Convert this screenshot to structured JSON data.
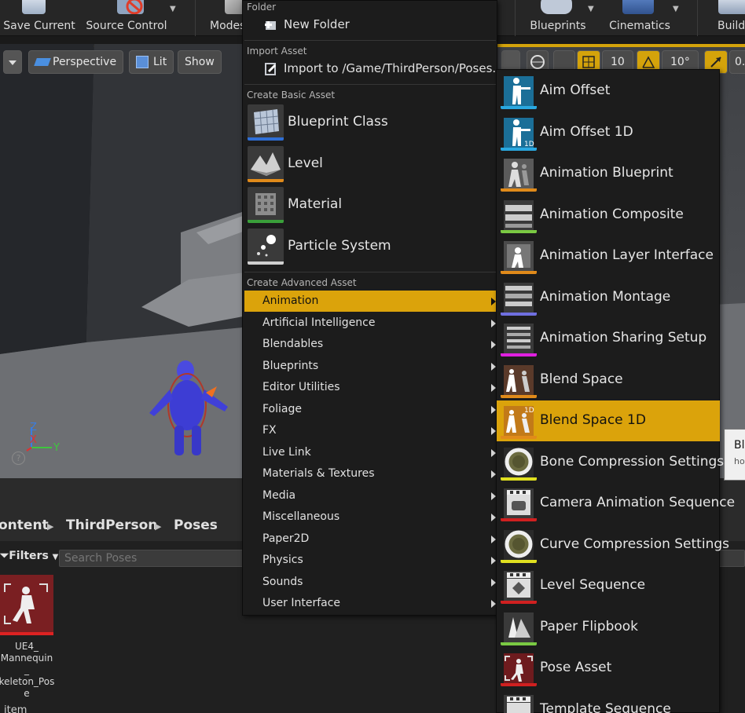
{
  "toolbar": {
    "save_current": "Save Current",
    "source_control": "Source Control",
    "modes": "Modes",
    "blueprints": "Blueprints",
    "cinematics": "Cinematics",
    "build": "Build"
  },
  "viewport": {
    "perspective": "Perspective",
    "lit": "Lit",
    "show": "Show",
    "grid_snap": "10",
    "rotation_snap": "10°",
    "scale_snap": "0.",
    "axis_z": "Z",
    "axis_x": "X",
    "axis_y": "Y",
    "help_glyph": "?"
  },
  "content_browser": {
    "breadcrumb": [
      "ontent",
      "ThirdPerson",
      "Poses"
    ],
    "filters_label": "Filters",
    "search_placeholder": "Search Poses",
    "asset_label": "UE4_ Mannequin_ keleton_Pose",
    "items_count": "item"
  },
  "tooltip": {
    "line1": "Bl",
    "line2": "ho"
  },
  "menu": {
    "folder_header": "Folder",
    "new_folder": "New Folder",
    "import_header": "Import Asset",
    "import_item": "Import to /Game/ThirdPerson/Poses...",
    "basic_header": "Create Basic Asset",
    "basic_items": [
      {
        "label": "Blueprint Class",
        "icon": "blueprint-class-icon",
        "color": "#2f6fd6"
      },
      {
        "label": "Level",
        "icon": "level-icon",
        "color": "#e08a1a"
      },
      {
        "label": "Material",
        "icon": "material-icon",
        "color": "#3aa03a"
      },
      {
        "label": "Particle System",
        "icon": "particle-system-icon",
        "color": "#d0d0d0"
      }
    ],
    "advanced_header": "Create Advanced Asset",
    "categories": [
      "Animation",
      "Artificial Intelligence",
      "Blendables",
      "Blueprints",
      "Editor Utilities",
      "Foliage",
      "FX",
      "Live Link",
      "Materials & Textures",
      "Media",
      "Miscellaneous",
      "Paper2D",
      "Physics",
      "Sounds",
      "User Interface"
    ],
    "selected_category": "Animation"
  },
  "submenu": {
    "items": [
      {
        "label": "Aim Offset",
        "icon": "aim-offset-icon",
        "color": "#2aa8e0"
      },
      {
        "label": "Aim Offset 1D",
        "icon": "aim-offset-1d-icon",
        "color": "#2aa8e0"
      },
      {
        "label": "Animation Blueprint",
        "icon": "animation-blueprint-icon",
        "color": "#e08a1a"
      },
      {
        "label": "Animation Composite",
        "icon": "animation-composite-icon",
        "color": "#7ac943"
      },
      {
        "label": "Animation Layer Interface",
        "icon": "animation-layer-interface-icon",
        "color": "#e08a1a"
      },
      {
        "label": "Animation Montage",
        "icon": "animation-montage-icon",
        "color": "#6f6fe0"
      },
      {
        "label": "Animation Sharing Setup",
        "icon": "animation-sharing-setup-icon",
        "color": "#e020e0"
      },
      {
        "label": "Blend Space",
        "icon": "blend-space-icon",
        "color": "#e08a1a"
      },
      {
        "label": "Blend Space 1D",
        "icon": "blend-space-1d-icon",
        "color": "#e08a1a"
      },
      {
        "label": "Bone Compression Settings",
        "icon": "bone-compression-settings-icon",
        "color": "#e0e020"
      },
      {
        "label": "Camera Animation Sequence",
        "icon": "camera-animation-sequence-icon",
        "color": "#d02020"
      },
      {
        "label": "Curve Compression Settings",
        "icon": "curve-compression-settings-icon",
        "color": "#e0e020"
      },
      {
        "label": "Level Sequence",
        "icon": "level-sequence-icon",
        "color": "#d02020"
      },
      {
        "label": "Paper Flipbook",
        "icon": "paper-flipbook-icon",
        "color": "#7ac943"
      },
      {
        "label": "Pose Asset",
        "icon": "pose-asset-icon",
        "color": "#d02020"
      },
      {
        "label": "Template Sequence",
        "icon": "template-sequence-icon",
        "color": "#d02020"
      }
    ],
    "selected_item": "Blend Space 1D"
  },
  "colors": {
    "accent": "#dba30b",
    "menu_bg": "#1c1c1c",
    "toolbar_bg": "#262626"
  }
}
